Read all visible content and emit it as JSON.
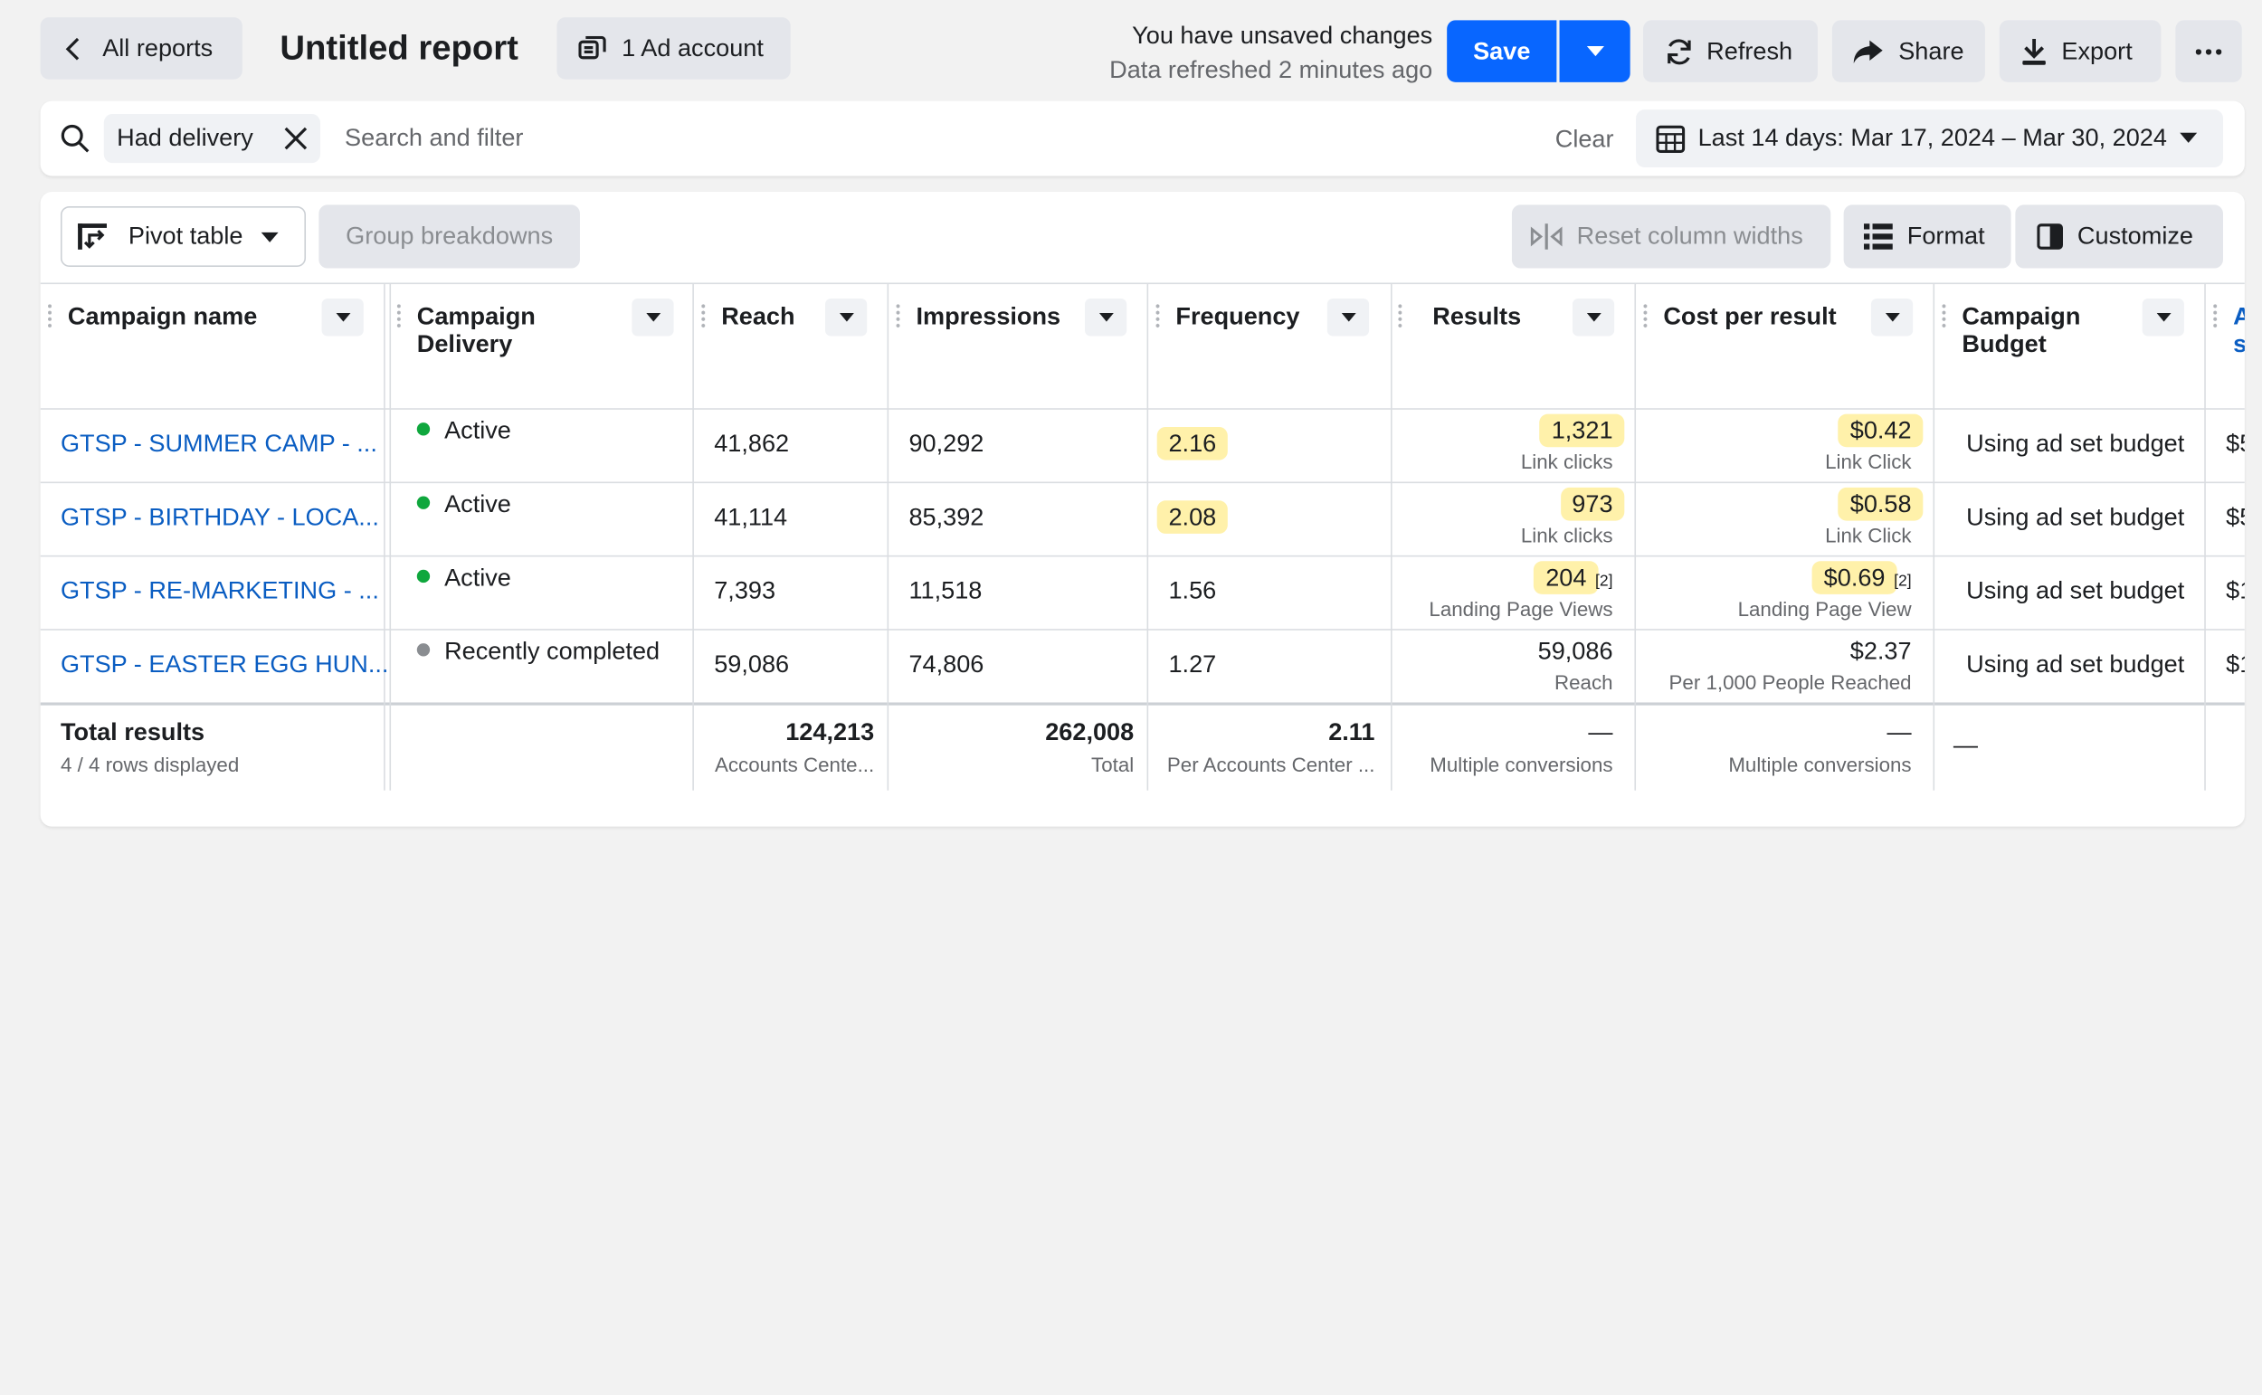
{
  "header": {
    "back_label": "All reports",
    "title": "Untitled report",
    "ad_account_label": "1 Ad account",
    "unsaved_text": "You have unsaved changes",
    "refreshed_text": "Data refreshed 2 minutes ago",
    "save_label": "Save",
    "refresh_label": "Refresh",
    "share_label": "Share",
    "export_label": "Export"
  },
  "filter": {
    "chip_label": "Had delivery",
    "search_placeholder": "Search and filter",
    "clear_label": "Clear",
    "date_range": "Last 14 days: Mar 17, 2024 – Mar 30, 2024"
  },
  "toolbar": {
    "pivot_label": "Pivot table",
    "group_label": "Group breakdowns",
    "reset_label": "Reset column widths",
    "format_label": "Format",
    "customize_label": "Customize"
  },
  "columns": {
    "campaign_name": "Campaign name",
    "delivery_1": "Campaign",
    "delivery_2": "Delivery",
    "reach": "Reach",
    "impressions": "Impressions",
    "frequency": "Frequency",
    "results": "Results",
    "cost_per_result": "Cost per result",
    "budget_1": "Campaign",
    "budget_2": "Budget",
    "next_1": "A",
    "next_2": "s"
  },
  "rows": [
    {
      "name": "GTSP - SUMMER CAMP - ...",
      "delivery": "Active",
      "reach": "41,862",
      "impressions": "90,292",
      "frequency": "2.16",
      "results": "1,321",
      "results_sub": "Link clicks",
      "cost": "$0.42",
      "cost_sub": "Link Click",
      "budget": "Using ad set budget",
      "next": "$5"
    },
    {
      "name": "GTSP - BIRTHDAY - LOCA...",
      "delivery": "Active",
      "reach": "41,114",
      "impressions": "85,392",
      "frequency": "2.08",
      "results": "973",
      "results_sub": "Link clicks",
      "cost": "$0.58",
      "cost_sub": "Link Click",
      "budget": "Using ad set budget",
      "next": "$5"
    },
    {
      "name": "GTSP - RE-MARKETING - ...",
      "delivery": "Active",
      "reach": "7,393",
      "impressions": "11,518",
      "frequency": "1.56",
      "results": "204",
      "results_note": "[2]",
      "results_sub": "Landing Page Views",
      "cost": "$0.69",
      "cost_note": "[2]",
      "cost_sub": "Landing Page View",
      "budget": "Using ad set budget",
      "next": "$1"
    },
    {
      "name": "GTSP - EASTER EGG HUN...",
      "delivery": "Recently completed",
      "reach": "59,086",
      "impressions": "74,806",
      "frequency": "1.27",
      "results": "59,086",
      "results_sub": "Reach",
      "cost": "$2.37",
      "cost_sub": "Per 1,000 People Reached",
      "budget": "Using ad set budget",
      "next": "$1"
    }
  ],
  "totals": {
    "label": "Total results",
    "rows_displayed": "4 / 4 rows displayed",
    "reach": "124,213",
    "reach_sub": "Accounts Cente...",
    "impressions": "262,008",
    "impressions_sub": "Total",
    "frequency": "2.11",
    "frequency_sub": "Per Accounts Center ...",
    "results": "—",
    "results_sub": "Multiple conversions",
    "cost": "—",
    "cost_sub": "Multiple conversions",
    "budget": "—"
  },
  "colors": {
    "primary": "#0866ff",
    "link": "#0a5dc2",
    "active": "#0fa73d",
    "completed": "#8a8d91",
    "highlight": "#ffe664"
  }
}
